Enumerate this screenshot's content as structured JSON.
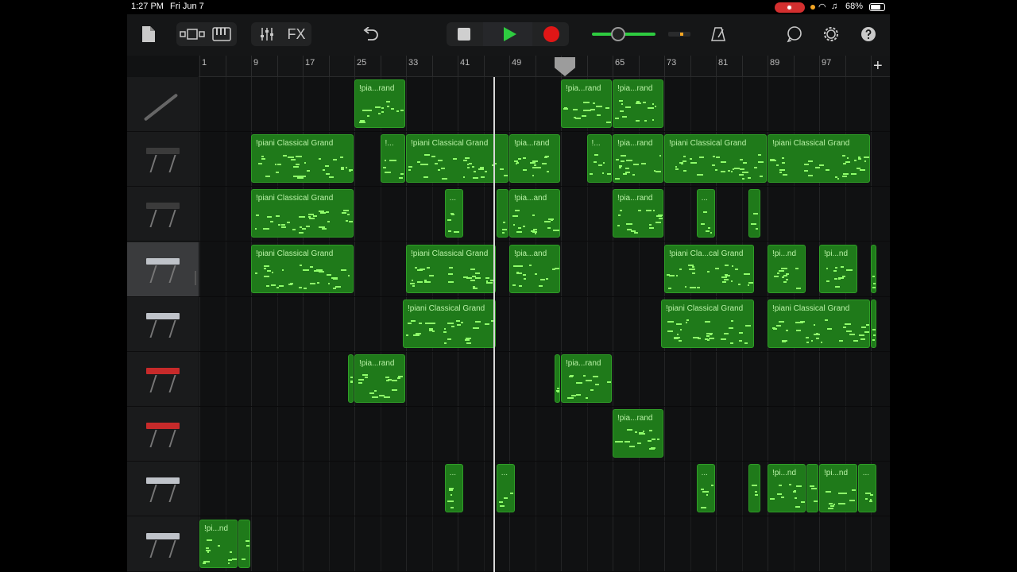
{
  "status": {
    "time": "1:27 PM",
    "date": "Fri Jun 7",
    "battery": "68%"
  },
  "toolbar": {
    "fx_label": "FX",
    "accent": "#2ecc40",
    "record_color": "#e01616"
  },
  "ruler": {
    "bars": [
      "1",
      "9",
      "17",
      "25",
      "33",
      "41",
      "49",
      "57",
      "65",
      "73",
      "81",
      "89",
      "97"
    ],
    "add_label": "+"
  },
  "tracks": [
    {
      "instrument": "oboe",
      "regions": [
        {
          "bar": 25,
          "len": 8,
          "title": "!pia...rand"
        },
        {
          "bar": 57,
          "len": 8,
          "title": "!pia...rand"
        },
        {
          "bar": 65,
          "len": 8,
          "title": "!pia...rand"
        }
      ]
    },
    {
      "instrument": "keyboard-dark",
      "regions": [
        {
          "bar": 9,
          "len": 16,
          "title": "!piani Classical Grand"
        },
        {
          "bar": 29,
          "len": 4,
          "title": "!..."
        },
        {
          "bar": 33,
          "len": 16,
          "title": "!piani Classical Grand"
        },
        {
          "bar": 49,
          "len": 8,
          "title": "!pia...rand"
        },
        {
          "bar": 61,
          "len": 4,
          "title": "!..."
        },
        {
          "bar": 65,
          "len": 8,
          "title": "!pia...rand"
        },
        {
          "bar": 73,
          "len": 16,
          "title": "!piani Classical Grand"
        },
        {
          "bar": 89,
          "len": 16,
          "title": "!piani Classical Grand"
        }
      ]
    },
    {
      "instrument": "keyboard-dark",
      "regions": [
        {
          "bar": 9,
          "len": 16,
          "title": "!piani Classical Grand"
        },
        {
          "bar": 39,
          "len": 3,
          "title": "..."
        },
        {
          "bar": 47,
          "len": 2,
          "title": ""
        },
        {
          "bar": 49,
          "len": 8,
          "title": "!pia...and"
        },
        {
          "bar": 65,
          "len": 8,
          "title": "!pia...rand"
        },
        {
          "bar": 78,
          "len": 3,
          "title": "..."
        },
        {
          "bar": 86,
          "len": 2,
          "title": ""
        }
      ]
    },
    {
      "instrument": "keyboard-silver",
      "selected": true,
      "regions": [
        {
          "bar": 9,
          "len": 16,
          "title": "!piani Classical Grand"
        },
        {
          "bar": 33,
          "len": 14,
          "title": "!piani Classical Grand"
        },
        {
          "bar": 49,
          "len": 8,
          "title": "!pia...and"
        },
        {
          "bar": 73,
          "len": 14,
          "title": "!piani Cla...cal Grand"
        },
        {
          "bar": 89,
          "len": 6,
          "title": "!pi...nd"
        },
        {
          "bar": 97,
          "len": 6,
          "title": "!pi...nd"
        },
        {
          "bar": 105,
          "len": 1,
          "title": ""
        }
      ]
    },
    {
      "instrument": "keyboard-silver",
      "regions": [
        {
          "bar": 32.5,
          "len": 14.5,
          "title": "!piani Classical Grand"
        },
        {
          "bar": 72.5,
          "len": 14.5,
          "title": "!piani Classical Grand"
        },
        {
          "bar": 89,
          "len": 16,
          "title": "!piani Classical Grand"
        },
        {
          "bar": 105,
          "len": 1,
          "title": ""
        }
      ]
    },
    {
      "instrument": "keyboard-red",
      "regions": [
        {
          "bar": 24,
          "len": 1,
          "title": ""
        },
        {
          "bar": 25,
          "len": 8,
          "title": "!pia...rand"
        },
        {
          "bar": 56,
          "len": 1,
          "title": ""
        },
        {
          "bar": 57,
          "len": 8,
          "title": "!pia...rand"
        }
      ]
    },
    {
      "instrument": "keyboard-red",
      "regions": [
        {
          "bar": 65,
          "len": 8,
          "title": "!pia...rand"
        }
      ]
    },
    {
      "instrument": "keyboard-silver",
      "regions": [
        {
          "bar": 39,
          "len": 3,
          "title": "..."
        },
        {
          "bar": 47,
          "len": 3,
          "title": "..."
        },
        {
          "bar": 78,
          "len": 3,
          "title": "..."
        },
        {
          "bar": 86,
          "len": 2,
          "title": ""
        },
        {
          "bar": 89,
          "len": 6,
          "title": "!pi...nd"
        },
        {
          "bar": 95,
          "len": 2,
          "title": ""
        },
        {
          "bar": 97,
          "len": 6,
          "title": "!pi...nd"
        },
        {
          "bar": 103,
          "len": 3,
          "title": "..."
        }
      ]
    },
    {
      "instrument": "keyboard-silver",
      "regions": [
        {
          "bar": 1,
          "len": 6,
          "title": "!pi...nd"
        },
        {
          "bar": 7,
          "len": 2,
          "title": ""
        }
      ]
    }
  ]
}
